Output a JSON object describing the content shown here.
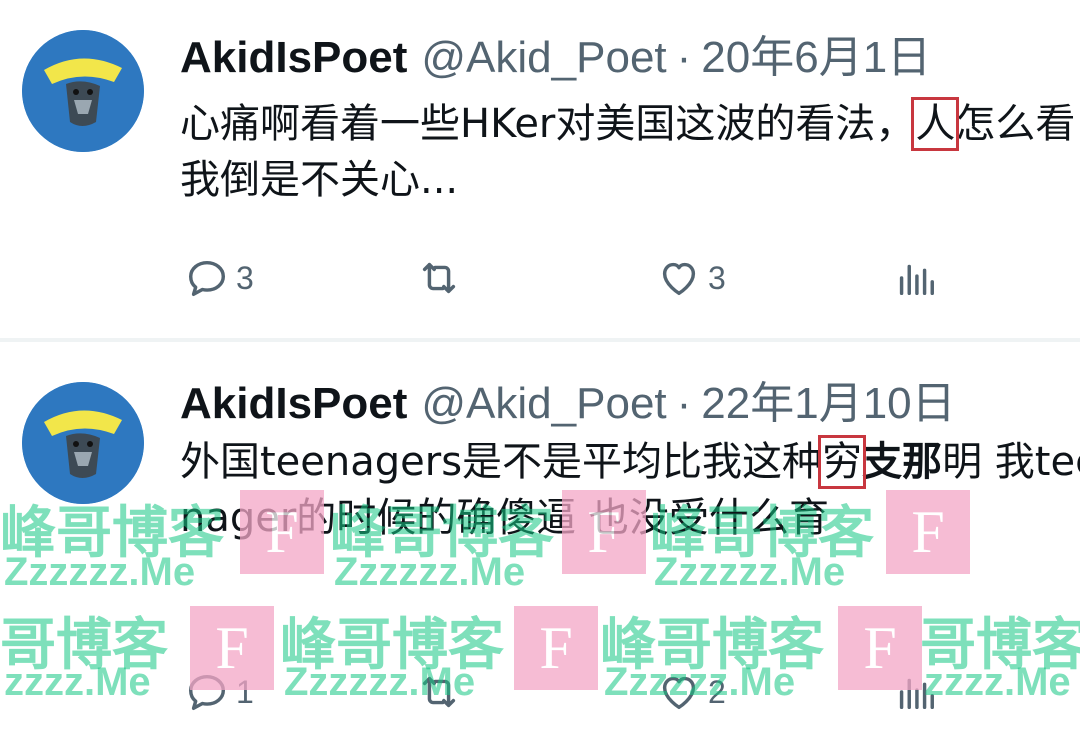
{
  "tweets": [
    {
      "display_name": "AkidIsPoet",
      "handle": "@Akid_Poet",
      "separator": "·",
      "date": "20年6月1日",
      "text_before": "心痛啊看着一些HKer对美国这波的看法，",
      "text_highlight": "人",
      "text_after": "怎么看我倒是不关心...",
      "reply_count": "3",
      "retweet_count": "",
      "like_count": "3"
    },
    {
      "display_name": "AkidIsPoet",
      "handle": "@Akid_Poet",
      "separator": "·",
      "date": "22年1月10日",
      "text_before": "外国teenagers是不是平均比我这种",
      "text_highlight": "穷",
      "text_bold": "支那",
      "text_after": "明 我teenager的时候的确傻逼 也没受什么育",
      "reply_count": "1",
      "retweet_count": "",
      "like_count": "2"
    }
  ],
  "watermark": {
    "cn": "峰哥博客",
    "cn_short": "哥博客",
    "en": "Zzzzzz.Me",
    "en_short": "zzzz.Me",
    "badge": "F"
  },
  "icons": {
    "reply": "reply-icon",
    "retweet": "retweet-icon",
    "like": "heart-icon",
    "views": "views-icon"
  },
  "colors": {
    "highlight_box": "#c8373f",
    "watermark_green": "#16c784",
    "watermark_pink": "#f3a6c6",
    "secondary_text": "#536471"
  }
}
